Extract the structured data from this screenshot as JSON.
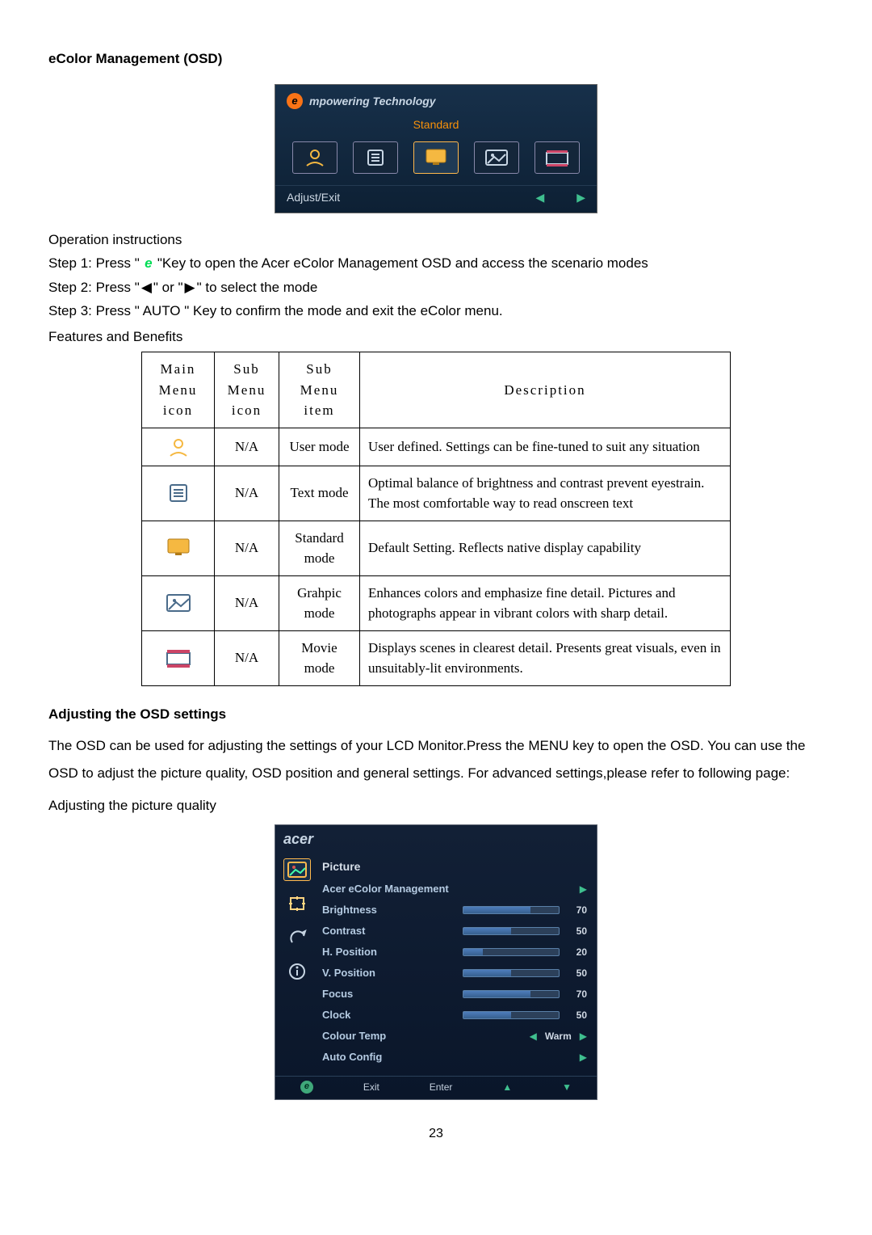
{
  "page_number": "23",
  "headings": {
    "h1": "eColor Management (OSD)",
    "h2": "Adjusting the OSD settings"
  },
  "ecolor_panel": {
    "brand_text": "mpowering Technology",
    "mode_label": "Standard",
    "footer_left": "Adjust/Exit",
    "icons": [
      "user-icon",
      "text-icon",
      "standard-icon",
      "graphic-icon",
      "movie-icon"
    ]
  },
  "operation": {
    "title": "Operation instructions",
    "step1_pre": "Step 1: Press \" ",
    "step1_post": " \"Key to open the Acer eColor Management OSD and access the scenario modes",
    "step2_pre": "Step 2: Press \" ",
    "step2_mid": " \" or \" ",
    "step2_post": " \" to select the mode",
    "step3": "Step 3: Press \" AUTO \" Key to confirm the mode and exit the eColor menu."
  },
  "features_title": "Features and Benefits",
  "table_headers": {
    "c1": "Main Menu icon",
    "c2": "Sub Menu icon",
    "c3": "Sub Menu item",
    "c4": "Description"
  },
  "table_rows": [
    {
      "icon": "user-icon",
      "sub": "N/A",
      "item": "User mode",
      "desc": "User defined. Settings can be fine-tuned to suit any situation"
    },
    {
      "icon": "text-icon",
      "sub": "N/A",
      "item": "Text mode",
      "desc": "Optimal balance of brightness and contrast prevent eyestrain. The most comfortable way to read onscreen text"
    },
    {
      "icon": "standard-icon",
      "sub": "N/A",
      "item": "Standard mode",
      "desc": "Default Setting. Reflects native display capability"
    },
    {
      "icon": "graphic-icon",
      "sub": "N/A",
      "item": "Grahpic mode",
      "desc": "Enhances colors and emphasize fine detail. Pictures and photographs appear in vibrant colors with sharp detail."
    },
    {
      "icon": "movie-icon",
      "sub": "N/A",
      "item": "Movie mode",
      "desc": "Displays scenes in clearest detail. Presents great visuals, even in unsuitably-lit environments."
    }
  ],
  "adjust_section": {
    "para": "The OSD can be used for adjusting the settings of your LCD Monitor.Press the MENU key to open the OSD. You can use the OSD to adjust the picture quality, OSD position and general settings. For advanced settings,please refer to following page:",
    "sub": "Adjusting the picture quality"
  },
  "osd_panel": {
    "logo": "acer",
    "section": "Picture",
    "items": [
      {
        "label": "Acer eColor Management",
        "type": "nav"
      },
      {
        "label": "Brightness",
        "type": "slider",
        "value": 70
      },
      {
        "label": "Contrast",
        "type": "slider",
        "value": 50
      },
      {
        "label": "H. Position",
        "type": "slider",
        "value": 20
      },
      {
        "label": "V. Position",
        "type": "slider",
        "value": 50
      },
      {
        "label": "Focus",
        "type": "slider",
        "value": 70
      },
      {
        "label": "Clock",
        "type": "slider",
        "value": 50
      },
      {
        "label": "Colour Temp",
        "type": "option",
        "text": "Warm"
      },
      {
        "label": "Auto Config",
        "type": "nav"
      }
    ],
    "bottom": {
      "b1": "Exit",
      "b2": "Enter"
    }
  }
}
